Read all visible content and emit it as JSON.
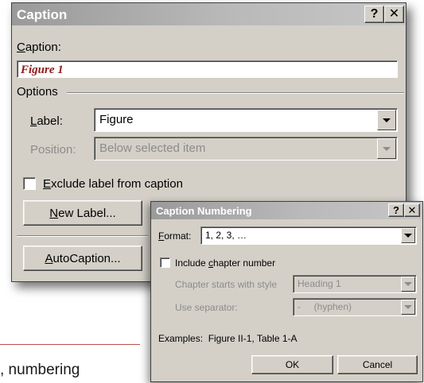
{
  "document": {
    "visible_text": ", numbering"
  },
  "caption_dialog": {
    "title": "Caption",
    "help_label": "?",
    "close_label": "✕",
    "caption_label_prefix": "",
    "caption_label_ul": "C",
    "caption_label_rest": "aption:",
    "caption_value": "Figure 1",
    "options_group_label": "Options",
    "label_field_ul": "L",
    "label_field_rest": "abel:",
    "label_value": "Figure",
    "position_label": "Position:",
    "position_value": "Below selected item",
    "exclude_ul": "E",
    "exclude_rest": "xclude label from caption",
    "exclude_checked": false,
    "new_label_ul": "N",
    "new_label_rest": "ew Label...",
    "autocaption_pre": "",
    "autocaption_ul": "A",
    "autocaption_rest": "utoCaption..."
  },
  "numbering_dialog": {
    "title": "Caption Numbering",
    "help_label": "?",
    "close_label": "✕",
    "format_ul": "F",
    "format_rest": "ormat:",
    "format_value": "1, 2, 3, …",
    "include_pre": "Include ",
    "include_ul": "c",
    "include_rest": "hapter number",
    "include_checked": false,
    "chapter_style_label": "Chapter starts with style",
    "chapter_style_value": "Heading 1",
    "separator_label": "Use separator:",
    "separator_value": "-     (hyphen)",
    "examples_text": "Examples:  Figure II-1, Table 1-A",
    "ok_label": "OK",
    "cancel_label": "Cancel"
  },
  "colors": {
    "dialog_face": "#d4d0c8",
    "caption_text": "#8b1a1a",
    "doc_rule": "#c0504d",
    "disabled_text": "#8c8c8c"
  }
}
